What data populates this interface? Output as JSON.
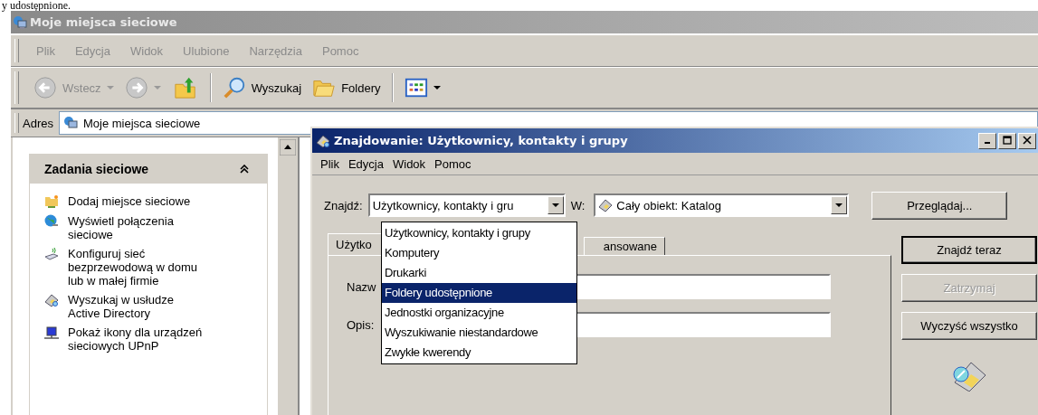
{
  "caption": "y udostępnione.",
  "explorer": {
    "title": "Moje miejsca sieciowe",
    "menu": [
      "Plik",
      "Edycja",
      "Widok",
      "Ulubione",
      "Narzędzia",
      "Pomoc"
    ],
    "toolbar": {
      "back": "Wstecz",
      "search": "Wyszukaj",
      "folders": "Foldery"
    },
    "address": {
      "label": "Adres",
      "value": "Moje miejsca sieciowe"
    },
    "tasks": {
      "title": "Zadania sieciowe",
      "expanded": true,
      "items": [
        {
          "label": "Dodaj miejsce sieciowe"
        },
        {
          "label": "Wyświetl połączenia sieciowe"
        },
        {
          "label": "Konfiguruj sieć bezprzewodową w domu lub w małej firmie"
        },
        {
          "label": "Wyszukaj w usłudze Active Directory"
        },
        {
          "label": "Pokaż ikony dla urządzeń sieciowych UPnP"
        }
      ]
    }
  },
  "dialog": {
    "title": "Znajdowanie: Użytkownicy, kontakty i grupy",
    "menu": [
      "Plik",
      "Edycja",
      "Widok",
      "Pomoc"
    ],
    "find_label": "Znajdź:",
    "find_value": "Użytkownicy, kontakty i gru",
    "in_label": "W:",
    "in_value": "Cały obiekt: Katalog",
    "browse": "Przeglądaj...",
    "tabs": [
      {
        "label": "Użytko",
        "selected": true
      },
      {
        "label": "ansowane",
        "selected": false
      }
    ],
    "fields": [
      {
        "label": "Nazw"
      },
      {
        "label": "Opis:"
      }
    ],
    "buttons": [
      {
        "label": "Znajdź teraz",
        "disabled": false,
        "default": true
      },
      {
        "label": "Zatrzymaj",
        "disabled": true,
        "default": false
      },
      {
        "label": "Wyczyść wszystko",
        "disabled": false,
        "default": false
      }
    ],
    "dropdown": [
      {
        "label": "Użytkownicy, kontakty i grupy",
        "selected": false
      },
      {
        "label": "Komputery",
        "selected": false
      },
      {
        "label": "Drukarki",
        "selected": false
      },
      {
        "label": "Foldery udostępnione",
        "selected": true
      },
      {
        "label": "Jednostki organizacyjne",
        "selected": false
      },
      {
        "label": "Wyszukiwanie niestandardowe",
        "selected": false
      },
      {
        "label": "Zwykłe kwerendy",
        "selected": false
      }
    ]
  }
}
